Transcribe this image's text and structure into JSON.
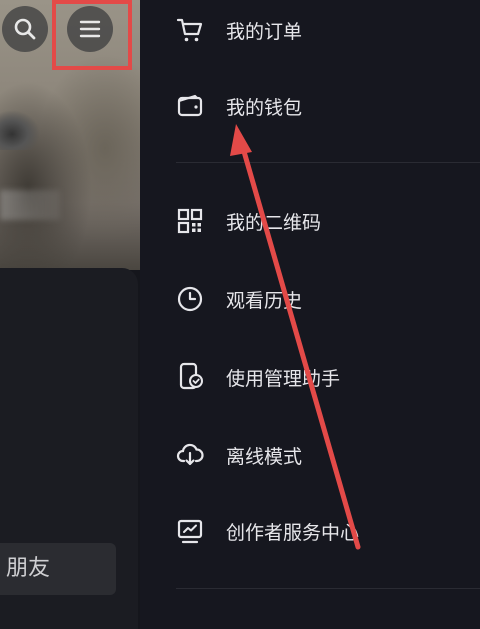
{
  "left_panel": {
    "friend_button_label": "朋友"
  },
  "menu": {
    "items": [
      {
        "label": "我的订单",
        "icon": "cart-icon"
      },
      {
        "label": "我的钱包",
        "icon": "wallet-icon"
      },
      {
        "label": "我的二维码",
        "icon": "qr-code-icon"
      },
      {
        "label": "观看历史",
        "icon": "clock-icon"
      },
      {
        "label": "使用管理助手",
        "icon": "phone-check-icon"
      },
      {
        "label": "离线模式",
        "icon": "cloud-download-icon"
      },
      {
        "label": "创作者服务中心",
        "icon": "monitor-chart-icon"
      }
    ]
  },
  "colors": {
    "annotation": "#e34a48",
    "drawer_bg": "#16171f",
    "text": "#e6e6ea"
  }
}
